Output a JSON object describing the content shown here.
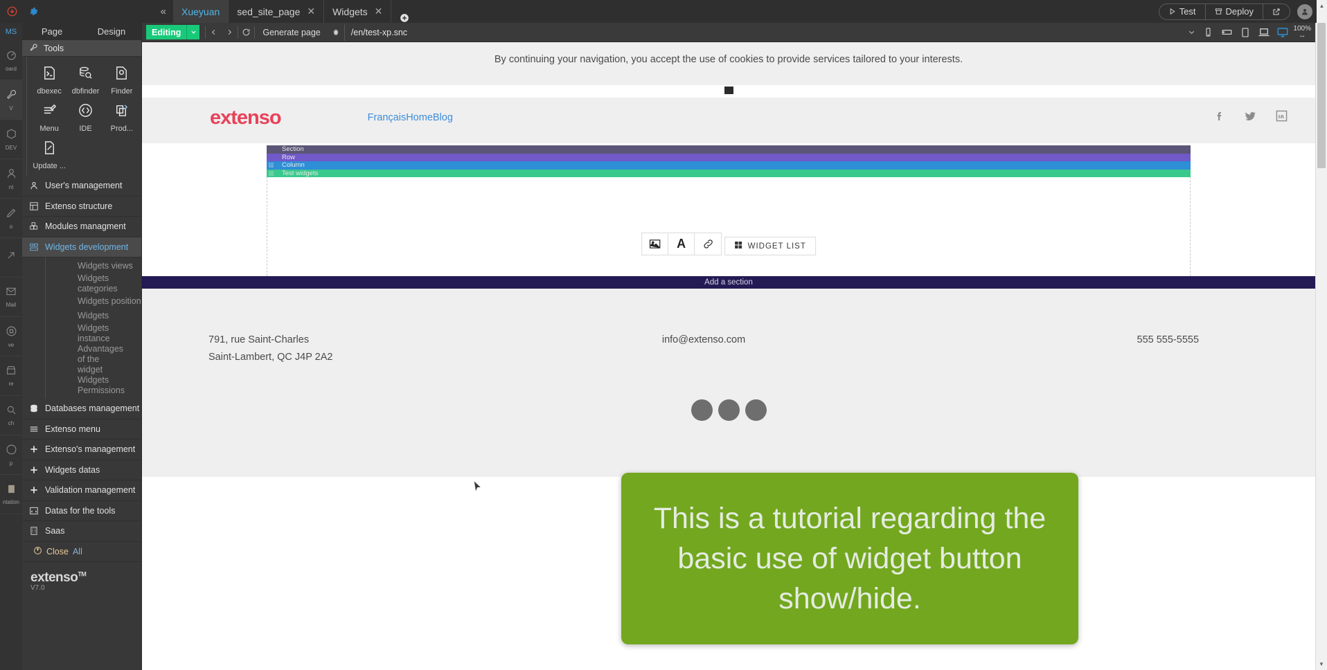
{
  "topbar": {
    "cloud_icon": "cloud-download-icon",
    "gear_icon": "gear-icon",
    "collapse_label": "«",
    "tabs": [
      {
        "label": "Xueyuan",
        "closable": false,
        "active": true
      },
      {
        "label": "sed_site_page",
        "closable": true,
        "active": false
      },
      {
        "label": "Widgets",
        "closable": true,
        "active": false
      }
    ],
    "add_tab_icon": "plus-circle-icon",
    "test_label": "Test",
    "deploy_label": "Deploy",
    "external_icon": "external-link-icon",
    "avatar_icon": "user-avatar-icon"
  },
  "rail": {
    "title": "MS",
    "items": [
      {
        "icon": "dashboard-icon",
        "label": "oard",
        "active": false
      },
      {
        "icon": "wrench-icon",
        "label": "V",
        "active": true
      },
      {
        "icon": "cube-icon",
        "label": "DEV",
        "active": false
      },
      {
        "icon": "user-icon",
        "label": "nt",
        "active": false
      },
      {
        "icon": "pen-icon",
        "label": "o",
        "active": false
      },
      {
        "icon": "arrow-icon",
        "label": "",
        "active": false
      },
      {
        "icon": "mail-icon",
        "label": "Mail",
        "active": false
      },
      {
        "icon": "archive-icon",
        "label": "ve",
        "active": false
      },
      {
        "icon": "store-icon",
        "label": "re",
        "active": false
      },
      {
        "icon": "search-icon",
        "label": "ch",
        "active": false
      },
      {
        "icon": "help-icon",
        "label": "p",
        "active": false
      },
      {
        "icon": "doc-icon",
        "label": "ntation",
        "active": false
      }
    ]
  },
  "sidebar": {
    "tabs": [
      {
        "label": "Page"
      },
      {
        "label": "Design"
      }
    ],
    "tools_header": {
      "icon": "wrench-icon",
      "label": "Tools"
    },
    "tools": [
      {
        "icon": "terminal-icon",
        "label": "dbexec"
      },
      {
        "icon": "db-search-icon",
        "label": "dbfinder"
      },
      {
        "icon": "finder-icon",
        "label": "Finder"
      },
      {
        "icon": "menu-edit-icon",
        "label": "Menu"
      },
      {
        "icon": "code-icon",
        "label": "IDE"
      },
      {
        "icon": "prod-icon",
        "label": "Prod..."
      },
      {
        "icon": "file-edit-icon",
        "label": "Update ..."
      }
    ],
    "items": [
      {
        "icon": "user-icon",
        "label": "User's management",
        "active": false
      },
      {
        "icon": "structure-icon",
        "label": "Extenso structure",
        "active": false
      },
      {
        "icon": "modules-icon",
        "label": "Modules managment",
        "active": false
      },
      {
        "icon": "widgets-icon",
        "label": "Widgets development",
        "active": true
      }
    ],
    "sub_items": [
      "Widgets views",
      "Widgets categories",
      "Widgets position",
      "Widgets",
      "Widgets instance",
      "Advantages of the widget",
      "Widgets Permissions"
    ],
    "items_after": [
      {
        "icon": "database-icon",
        "label": "Databases management"
      },
      {
        "icon": "hamburger-icon",
        "label": "Extenso menu"
      },
      {
        "icon": "plus-icon",
        "label": "Extenso's management"
      },
      {
        "icon": "plus-icon",
        "label": "Widgets datas"
      },
      {
        "icon": "plus-icon",
        "label": "Validation management"
      },
      {
        "icon": "data-tools-icon",
        "label": "Datas for the tools"
      },
      {
        "icon": "building-icon",
        "label": "Saas"
      }
    ],
    "close_all": {
      "icon": "power-icon",
      "label_1": "Close ",
      "label_2": "All"
    },
    "footer_logo": "extenso",
    "footer_tm": "TM",
    "footer_version": "V7.0"
  },
  "editor_toolbar": {
    "mode_label": "Editing",
    "caret_icon": "chevron-down-icon",
    "back_icon": "chevron-left-icon",
    "forward_icon": "chevron-right-icon",
    "refresh_icon": "refresh-icon",
    "generate_label": "Generate page",
    "settings_icon": "gear-icon",
    "url_value": "/en/test-xp.snc",
    "url_caret_icon": "chevron-down-icon",
    "devices": [
      "mobile-portrait-icon",
      "mobile-landscape-icon",
      "tablet-icon",
      "laptop-icon",
      "desktop-icon"
    ],
    "active_device": "desktop-icon",
    "zoom_label": "100%",
    "zoom_icon": "resize-horizontal-icon"
  },
  "preview": {
    "cookie_text": "By continuing your navigation, you accept the use of cookies to provide services tailored to your interests.",
    "cookie_close_icon": "close-square-icon",
    "site_logo": "extenso",
    "site_nav": "FrançaisHomeBlog",
    "social_icons": [
      "facebook-icon",
      "twitter-icon",
      "linkedin-icon"
    ],
    "stack_bars": [
      {
        "label": "Section",
        "color": "#5b5577"
      },
      {
        "label": "Row",
        "color": "#7159c9"
      },
      {
        "label": "Column",
        "color": "#2e8ed6"
      },
      {
        "label": "Test widgets",
        "color": "#39c98c"
      }
    ],
    "widget_tools": [
      {
        "icon": "image-icon"
      },
      {
        "icon": "text-icon",
        "glyph": "A"
      },
      {
        "icon": "link-icon"
      }
    ],
    "widget_list_label": "WIDGET LIST",
    "widget_list_icon": "grid-icon",
    "add_section_label": "Add a section",
    "footer": {
      "address_line1": "791, rue Saint-Charles",
      "address_line2": "Saint-Lambert, QC J4P 2A2",
      "email": "info@extenso.com",
      "phone": "555 555-5555"
    }
  },
  "tutorial": {
    "text": "This is a tutorial regarding the basic use of widget button show/hide.",
    "background_color": "#73a71f",
    "text_color": "#e4ece0"
  },
  "scrollbar": {
    "up_icon": "triangle-up-icon",
    "down_icon": "triangle-down-icon"
  }
}
